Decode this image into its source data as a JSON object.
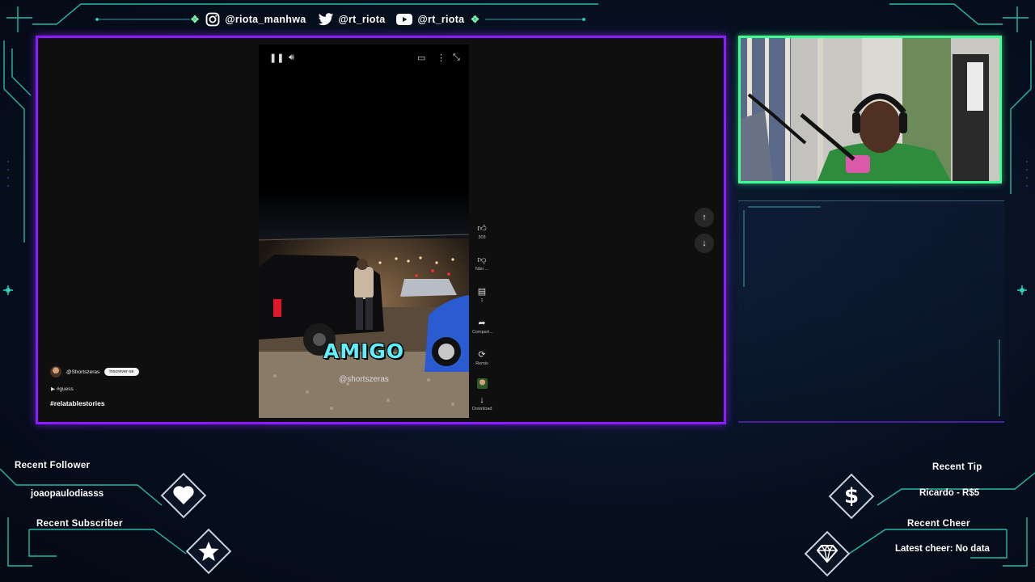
{
  "social": {
    "instagram": "@riota_manhwa",
    "twitter": "@rt_riota",
    "youtube": "@rt_riota"
  },
  "video": {
    "caption": "AMIGO",
    "watermark": "@shortszeras",
    "channel": "@Shortszeras",
    "subscribe_label": "Inscrever-se",
    "tag_line": "#guess",
    "hashtag": "#relatablestories"
  },
  "actions": {
    "likes": "303",
    "dislike_label": "Não ...",
    "comments": "1",
    "share_label": "Compart...",
    "remix_label": "Remix",
    "download_label": "Download"
  },
  "widgets": {
    "recent_follower_title": "Recent Follower",
    "recent_follower_value": "joaopaulodiasss",
    "recent_subscriber_title": "Recent Subscriber",
    "recent_subscriber_value": "",
    "recent_tip_title": "Recent Tip",
    "recent_tip_value": "Ricardo - R$5",
    "recent_cheer_title": "Recent Cheer",
    "recent_cheer_value": "Latest cheer: No data"
  },
  "colors": {
    "main_frame": "#8a1cff",
    "cam_frame": "#3dff94",
    "accent_lines": "#2fe0c0",
    "caption": "#5ff0ff"
  }
}
